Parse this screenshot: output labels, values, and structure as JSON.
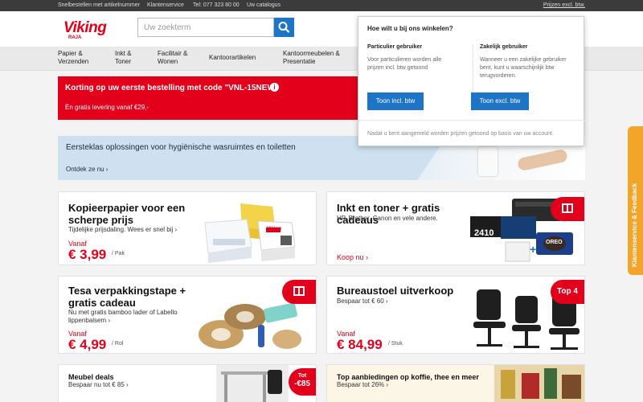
{
  "topbar": {
    "links": [
      "Snelbestellen met artikelnummer",
      "Klantenservice",
      "Tel: 077 323 80 00",
      "Uw catalogus"
    ],
    "price_toggle": "Prijzen excl. btw."
  },
  "header": {
    "logo_text": "Viking",
    "logo_sub": "RAJA",
    "search_placeholder": "Uw zoekterm"
  },
  "nav": {
    "items": [
      "Papier & Verzenden",
      "Inkt & Toner",
      "Facilitair & Wonen",
      "Kantoorartikelen",
      "Kantoormeubelen & Presentatie"
    ]
  },
  "promo": {
    "title": "Korting op uw eerste bestelling met code \"VNL-15NEW\"",
    "subtitle": "Èn gratis levering vanaf €29,-"
  },
  "hygiene": {
    "title": "Eersteklas oplossingen voor hygiënische wasruimtes en toiletten",
    "link": "Ontdek ze nu ›"
  },
  "cards": {
    "paper": {
      "title": "Kopieerpapier voor een scherpe prijs",
      "subtitle": "Tijdelijke prijsdaling. Wees er snel bij ›",
      "vanaf": "Vanaf",
      "price": "€ 3,99",
      "unit": "/ Pak",
      "product_label": "Viking"
    },
    "ink": {
      "title": "Inkt en toner + gratis cadeaus",
      "subtitle": "HP, Brother, Canon en vele andere.",
      "link": "Koop nu ›",
      "box_label": "2410",
      "cookie_label": "OREO"
    },
    "tape": {
      "title": "Tesa verpakkingstape + gratis cadeau",
      "subtitle": "Nu met gratis bamboo lader of Labello lippenbalsem ›",
      "vanaf": "Vanaf",
      "price": "€ 4,99",
      "unit": "/ Rol"
    },
    "chair": {
      "title": "Bureaustoel uitverkoop",
      "subtitle": "Bespaar tot € 60 ›",
      "vanaf": "Vanaf",
      "price": "€ 84,99",
      "unit": "/ Stuk",
      "tag": "Top 4"
    },
    "furniture": {
      "title": "Meubel deals",
      "subtitle": "Bespaar nu tot € 85 ›",
      "tag_top": "Tot",
      "tag_bottom": "-€85"
    },
    "coffee": {
      "title": "Top aanbiedingen op koffie, thee en meer",
      "subtitle": "Bespaar tot 26% ›"
    }
  },
  "popover": {
    "title": "Hoe wilt u bij ons winkelen?",
    "private_head": "Particulier gebruiker",
    "private_text": "Voor particulieren worden alle prijzen incl. btw getoond",
    "private_button": "Toon incl. btw",
    "business_head": "Zakelijk gebruiker",
    "business_text": "Wanneer u een zakelijke gebruiker bent, kunt u waarschijnlijk btw terugvorderen.",
    "business_button": "Toon excl. btw",
    "footer": "Nadat u bent aangemeld worden prijzen getoond op basis van uw account."
  },
  "feedback": {
    "label": "Klantenservice & Feedback"
  },
  "colors": {
    "brand_red": "#e2001a",
    "button_blue": "#1e75c8",
    "feedback_orange": "#f3a52a"
  }
}
